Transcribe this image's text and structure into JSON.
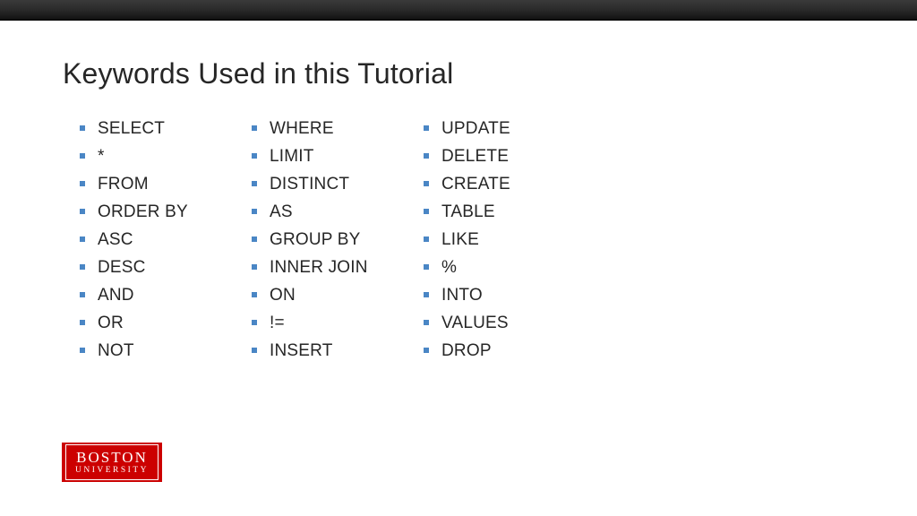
{
  "title": "Keywords Used in this Tutorial",
  "columns": [
    [
      "SELECT",
      "*",
      "FROM",
      "ORDER BY",
      "ASC",
      "DESC",
      "AND",
      "OR",
      "NOT"
    ],
    [
      "WHERE",
      "LIMIT",
      "DISTINCT",
      "AS",
      "GROUP BY",
      "INNER JOIN",
      "ON",
      "!=",
      "INSERT"
    ],
    [
      "UPDATE",
      "DELETE",
      "CREATE",
      "TABLE",
      "LIKE",
      " %",
      "INTO",
      "VALUES",
      "DROP"
    ]
  ],
  "logo": {
    "line1": "BOSTON",
    "line2": "UNIVERSITY"
  }
}
